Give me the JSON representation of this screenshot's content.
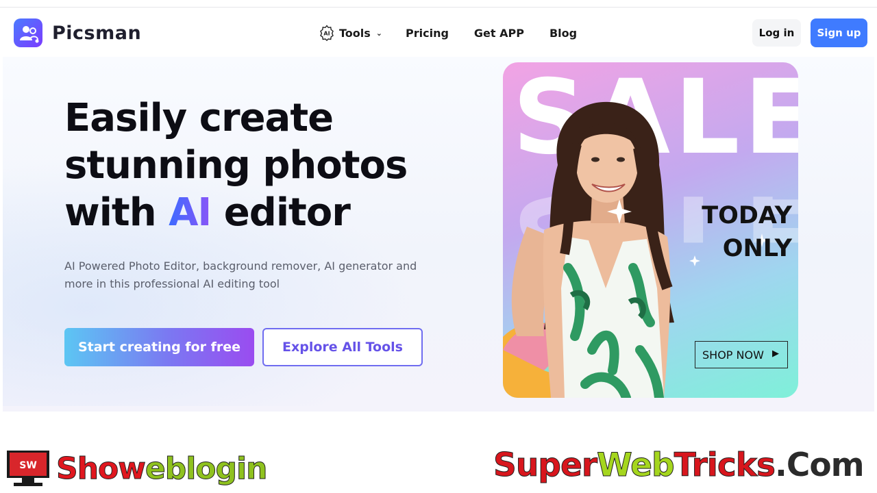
{
  "brand": {
    "name": "Picsman"
  },
  "nav": {
    "tools": "Tools",
    "tools_icon_text": "AI",
    "pricing": "Pricing",
    "get_app": "Get APP",
    "blog": "Blog"
  },
  "auth": {
    "login": "Log in",
    "signup": "Sign up"
  },
  "hero": {
    "headline_line1": "Easily create",
    "headline_line2": "stunning photos",
    "headline_with": "with ",
    "headline_ai": "AI",
    "headline_editor": " editor",
    "subtitle": "AI Powered Photo Editor, background remover, AI generator and more in this professional AI editing tool",
    "cta_primary": "Start creating for free",
    "cta_secondary": "Explore All Tools"
  },
  "promo": {
    "sale": "SALE",
    "today_line1": "TODAY",
    "today_line2": "ONLY",
    "shop_now": "SHOP NOW"
  },
  "watermark": {
    "left_part1": "Show",
    "left_part2": "eblogin",
    "monitor_text": "SW",
    "right_super": "Super",
    "right_web": "Web",
    "right_tricks": "Tricks",
    "right_com": ".Com"
  },
  "colors": {
    "accent": "#3f7bff",
    "ai_gradient_start": "#3d6bff",
    "ai_gradient_end": "#8a55f7",
    "cta_gradient_start": "#5cc6f3",
    "cta_gradient_end": "#9a4cf0",
    "secondary_border": "#6f6cf0"
  }
}
